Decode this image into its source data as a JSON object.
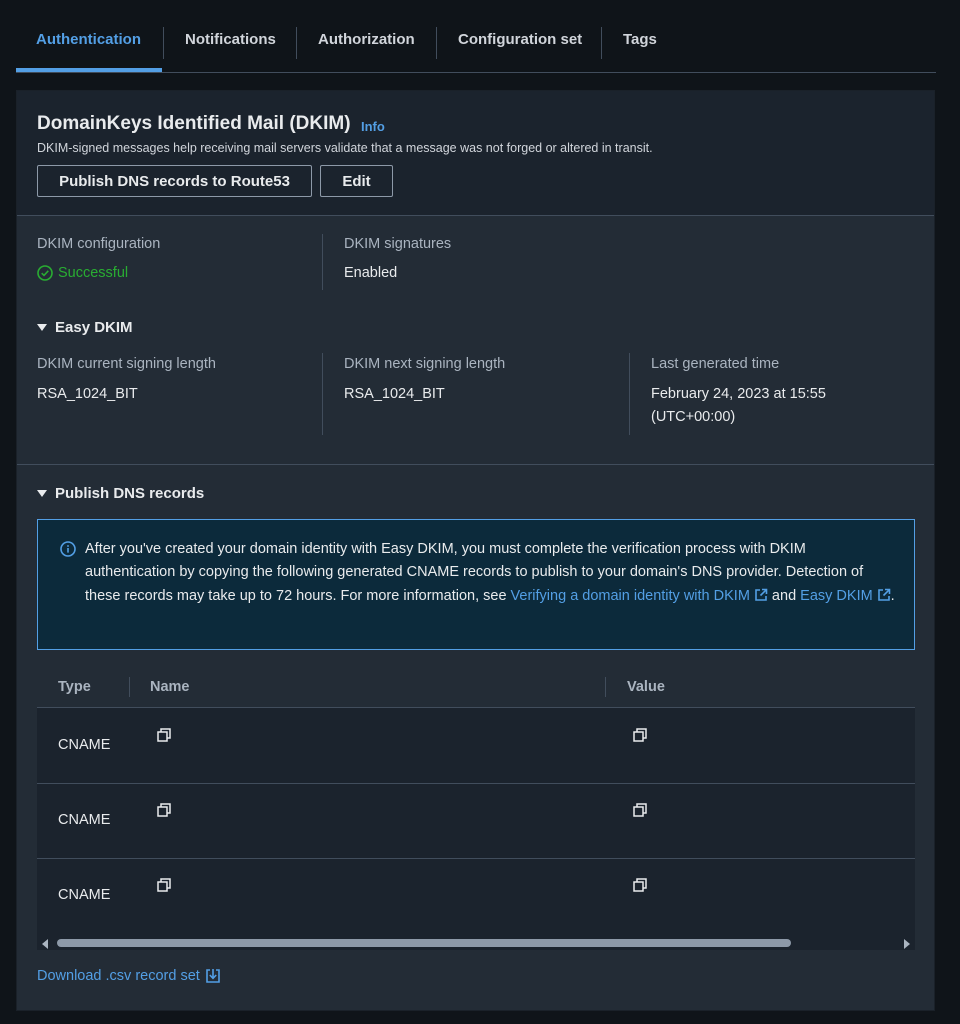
{
  "tabs": [
    {
      "label": "Authentication",
      "active": true
    },
    {
      "label": "Notifications"
    },
    {
      "label": "Authorization"
    },
    {
      "label": "Configuration set"
    },
    {
      "label": "Tags"
    }
  ],
  "header": {
    "title": "DomainKeys Identified Mail (DKIM)",
    "info": "Info",
    "description": "DKIM-signed messages help receiving mail servers validate that a message was not forged or altered in transit.",
    "publish_button": "Publish DNS records to Route53",
    "edit_button": "Edit"
  },
  "dkim": {
    "config_label": "DKIM configuration",
    "config_value": "Successful",
    "signatures_label": "DKIM signatures",
    "signatures_value": "Enabled"
  },
  "easy_dkim": {
    "title": "Easy DKIM",
    "current_label": "DKIM current signing length",
    "current_value": "RSA_1024_BIT",
    "next_label": "DKIM next signing length",
    "next_value": "RSA_1024_BIT",
    "last_label": "Last generated time",
    "last_value_line1": "February 24, 2023 at 15:55",
    "last_value_line2": "(UTC+00:00)"
  },
  "publish": {
    "title": "Publish DNS records",
    "alert_text": "After you've created your domain identity with Easy DKIM, you must complete the verification process with DKIM authentication by copying the following generated CNAME records to publish to your domain's DNS provider. Detection of these records may take up to 72 hours. For more information, see ",
    "link1": "Verifying a domain identity with DKIM",
    "and": " and ",
    "link2": "Easy DKIM",
    "period": "."
  },
  "table": {
    "headers": {
      "type": "Type",
      "name": "Name",
      "value": "Value"
    },
    "rows": [
      {
        "type": "CNAME",
        "name": "",
        "value": ""
      },
      {
        "type": "CNAME",
        "name": "",
        "value": ""
      },
      {
        "type": "CNAME",
        "name": "",
        "value": ""
      }
    ]
  },
  "download": "Download .csv record set",
  "colors": {
    "accent": "#539fe5",
    "success": "#29ad32",
    "background": "#232c36"
  },
  "icons": [
    "info-icon",
    "check-circle-icon",
    "external-link-icon",
    "copy-icon",
    "download-icon",
    "caret-down-icon"
  ]
}
